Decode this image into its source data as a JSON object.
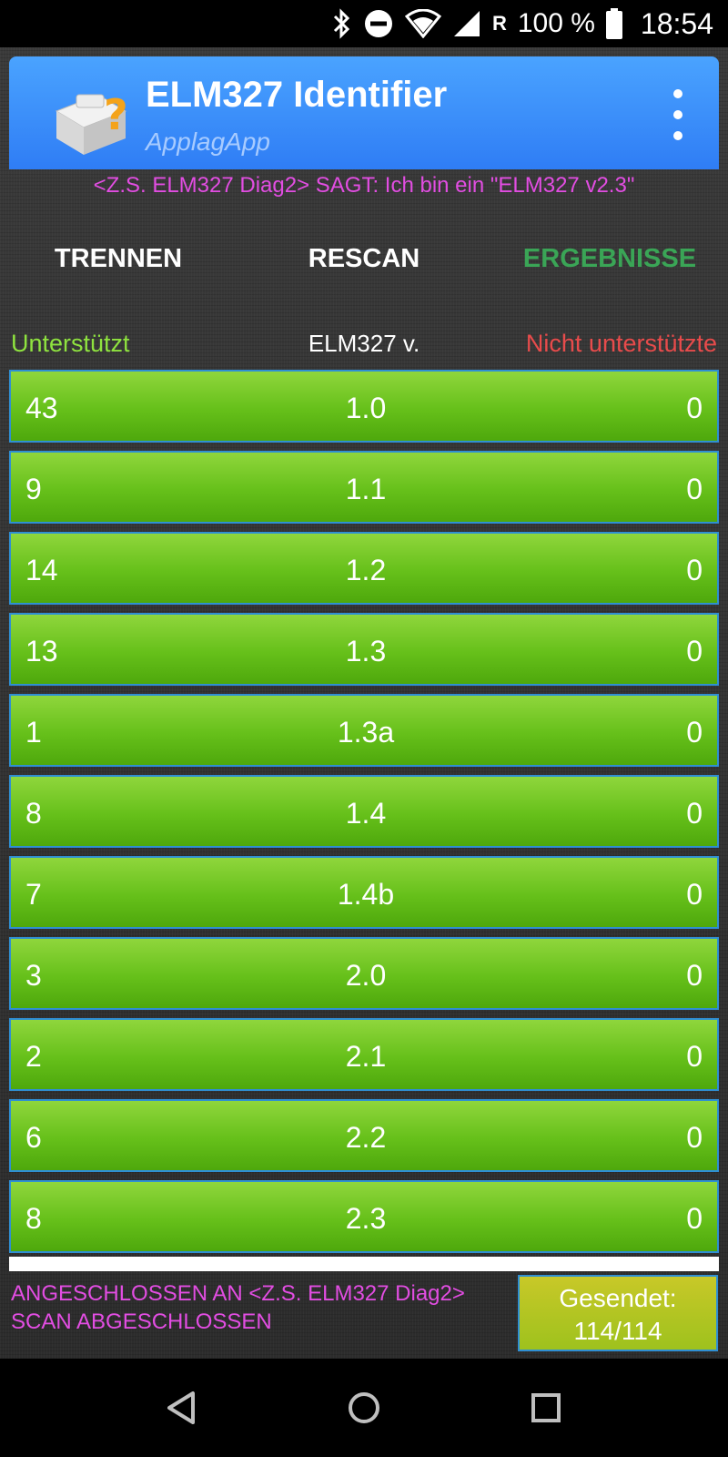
{
  "status_bar": {
    "battery": "100 %",
    "roaming": "R",
    "time": "18:54",
    "icons": [
      "bluetooth-icon",
      "do-not-disturb-icon",
      "wifi-icon",
      "signal-icon",
      "battery-icon"
    ]
  },
  "app": {
    "title": "ELM327 Identifier",
    "subtitle": "ApplagApp",
    "accent": "#3b8ef8"
  },
  "elm_says": "<Z.S. ELM327 Diag2> SAGT: Ich bin ein \"ELM327 v2.3\"",
  "actions": {
    "disconnect": "TRENNEN",
    "rescan": "RESCAN",
    "results": "ERGEBNISSE"
  },
  "columns": {
    "supported": "Unterstützt",
    "version": "ELM327 v.",
    "unsupported": "Nicht unterstützte"
  },
  "rows": [
    {
      "supported": "43",
      "version": "1.0",
      "unsupported": "0"
    },
    {
      "supported": "9",
      "version": "1.1",
      "unsupported": "0"
    },
    {
      "supported": "14",
      "version": "1.2",
      "unsupported": "0"
    },
    {
      "supported": "13",
      "version": "1.3",
      "unsupported": "0"
    },
    {
      "supported": "1",
      "version": "1.3a",
      "unsupported": "0"
    },
    {
      "supported": "8",
      "version": "1.4",
      "unsupported": "0"
    },
    {
      "supported": "7",
      "version": "1.4b",
      "unsupported": "0"
    },
    {
      "supported": "3",
      "version": "2.0",
      "unsupported": "0"
    },
    {
      "supported": "2",
      "version": "2.1",
      "unsupported": "0"
    },
    {
      "supported": "6",
      "version": "2.2",
      "unsupported": "0"
    },
    {
      "supported": "8",
      "version": "2.3",
      "unsupported": "0"
    }
  ],
  "footer": {
    "status_line1": "ANGESCHLOSSEN AN <Z.S. ELM327 Diag2>",
    "status_line2": "SCAN ABGESCHLOSSEN",
    "sent_label": "Gesendet:",
    "sent_value": "114/114"
  },
  "colors": {
    "row_green": "#66c01a",
    "supported_header": "#8fe33f",
    "unsupported_header": "#e84b4b",
    "results_tab": "#3aa556",
    "status_magenta": "#e24de2"
  }
}
